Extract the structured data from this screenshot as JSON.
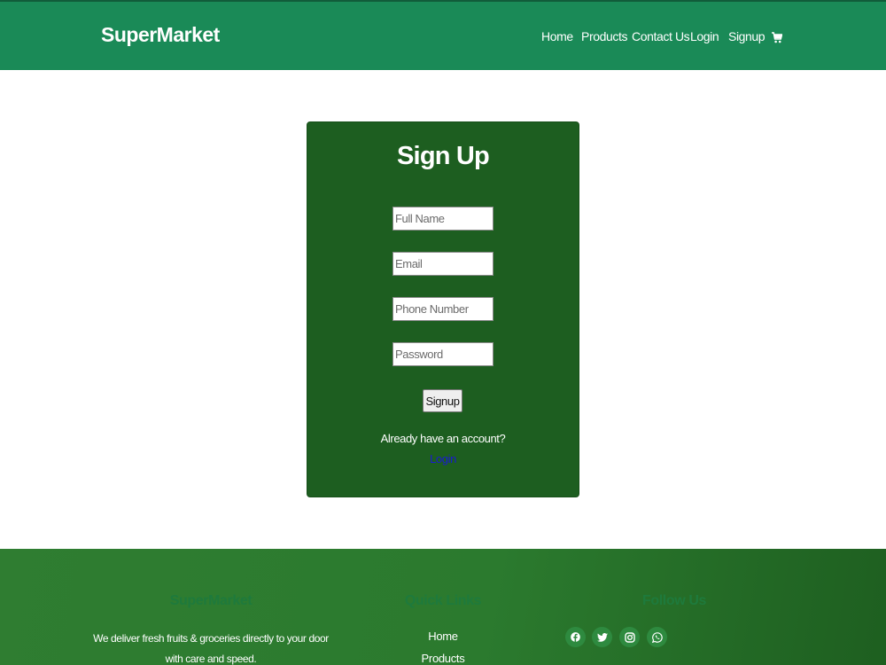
{
  "navbar": {
    "brand": "SuperMarket",
    "links": [
      "Home",
      "Products",
      "Contact Us",
      "Login",
      "Signup"
    ],
    "cart_icon": "cart-icon",
    "bg_color": "#1a8a57"
  },
  "signup": {
    "title": "Sign Up",
    "fields": {
      "full_name": {
        "placeholder": "Full Name",
        "value": ""
      },
      "email": {
        "placeholder": "Email",
        "value": ""
      },
      "phone": {
        "placeholder": "Phone Number",
        "value": ""
      },
      "password": {
        "placeholder": "Password",
        "value": ""
      }
    },
    "submit_label": "Signup",
    "already_text": "Already have an account?",
    "login_link": "Login",
    "card_color": "#1d5e20"
  },
  "footer": {
    "brand_heading": "SuperMarket",
    "about_text": "We deliver fresh fruits & groceries directly to your door with care and speed.",
    "quick_links_heading": "Quick Links",
    "quick_links": [
      "Home",
      "Products"
    ],
    "follow_heading": "Follow Us",
    "social_icons": [
      "facebook-icon",
      "twitter-icon",
      "instagram-icon",
      "whatsapp-icon"
    ]
  }
}
